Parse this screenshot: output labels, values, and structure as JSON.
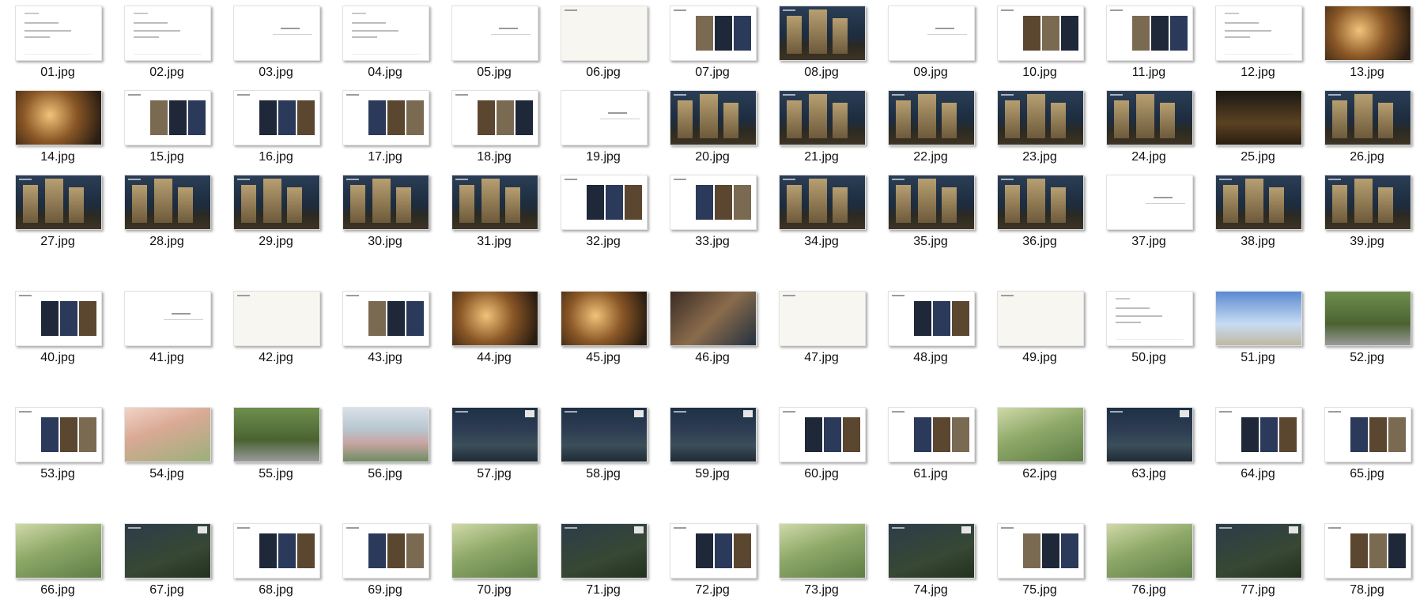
{
  "files": [
    {
      "name": "01.jpg",
      "style": "doc"
    },
    {
      "name": "02.jpg",
      "style": "doc"
    },
    {
      "name": "03.jpg",
      "style": "blank"
    },
    {
      "name": "04.jpg",
      "style": "doc"
    },
    {
      "name": "05.jpg",
      "style": "blank"
    },
    {
      "name": "06.jpg",
      "style": "plan"
    },
    {
      "name": "07.jpg",
      "style": "photos"
    },
    {
      "name": "08.jpg",
      "style": "night"
    },
    {
      "name": "09.jpg",
      "style": "blank"
    },
    {
      "name": "10.jpg",
      "style": "photos"
    },
    {
      "name": "11.jpg",
      "style": "photos"
    },
    {
      "name": "12.jpg",
      "style": "doc"
    },
    {
      "name": "13.jpg",
      "style": "warm"
    },
    {
      "name": "14.jpg",
      "style": "warm"
    },
    {
      "name": "15.jpg",
      "style": "photos"
    },
    {
      "name": "16.jpg",
      "style": "photos"
    },
    {
      "name": "17.jpg",
      "style": "photos"
    },
    {
      "name": "18.jpg",
      "style": "photos"
    },
    {
      "name": "19.jpg",
      "style": "blank"
    },
    {
      "name": "20.jpg",
      "style": "night"
    },
    {
      "name": "21.jpg",
      "style": "night"
    },
    {
      "name": "22.jpg",
      "style": "night"
    },
    {
      "name": "23.jpg",
      "style": "night"
    },
    {
      "name": "24.jpg",
      "style": "night"
    },
    {
      "name": "25.jpg",
      "style": "dark"
    },
    {
      "name": "26.jpg",
      "style": "night"
    },
    {
      "name": "27.jpg",
      "style": "night"
    },
    {
      "name": "28.jpg",
      "style": "night"
    },
    {
      "name": "29.jpg",
      "style": "night"
    },
    {
      "name": "30.jpg",
      "style": "night"
    },
    {
      "name": "31.jpg",
      "style": "night"
    },
    {
      "name": "32.jpg",
      "style": "photos"
    },
    {
      "name": "33.jpg",
      "style": "photos"
    },
    {
      "name": "34.jpg",
      "style": "night"
    },
    {
      "name": "35.jpg",
      "style": "night"
    },
    {
      "name": "36.jpg",
      "style": "night"
    },
    {
      "name": "37.jpg",
      "style": "blank"
    },
    {
      "name": "38.jpg",
      "style": "night"
    },
    {
      "name": "39.jpg",
      "style": "night"
    },
    {
      "name": "40.jpg",
      "style": "photos"
    },
    {
      "name": "41.jpg",
      "style": "blank"
    },
    {
      "name": "42.jpg",
      "style": "plan"
    },
    {
      "name": "43.jpg",
      "style": "photos"
    },
    {
      "name": "44.jpg",
      "style": "warm"
    },
    {
      "name": "45.jpg",
      "style": "warm"
    },
    {
      "name": "46.jpg",
      "style": "photo"
    },
    {
      "name": "47.jpg",
      "style": "plan"
    },
    {
      "name": "48.jpg",
      "style": "photos"
    },
    {
      "name": "49.jpg",
      "style": "plan"
    },
    {
      "name": "50.jpg",
      "style": "doc"
    },
    {
      "name": "51.jpg",
      "style": "sky"
    },
    {
      "name": "52.jpg",
      "style": "park"
    },
    {
      "name": "53.jpg",
      "style": "photos"
    },
    {
      "name": "54.jpg",
      "style": "pink"
    },
    {
      "name": "55.jpg",
      "style": "park"
    },
    {
      "name": "56.jpg",
      "style": "aerial"
    },
    {
      "name": "57.jpg",
      "style": "aernight"
    },
    {
      "name": "58.jpg",
      "style": "aernight"
    },
    {
      "name": "59.jpg",
      "style": "aernight"
    },
    {
      "name": "60.jpg",
      "style": "photos"
    },
    {
      "name": "61.jpg",
      "style": "photos"
    },
    {
      "name": "62.jpg",
      "style": "green"
    },
    {
      "name": "63.jpg",
      "style": "aernight"
    },
    {
      "name": "64.jpg",
      "style": "photos"
    },
    {
      "name": "65.jpg",
      "style": "photos"
    },
    {
      "name": "66.jpg",
      "style": "green"
    },
    {
      "name": "67.jpg",
      "style": "gnight"
    },
    {
      "name": "68.jpg",
      "style": "photos"
    },
    {
      "name": "69.jpg",
      "style": "photos"
    },
    {
      "name": "70.jpg",
      "style": "green"
    },
    {
      "name": "71.jpg",
      "style": "gnight"
    },
    {
      "name": "72.jpg",
      "style": "photos"
    },
    {
      "name": "73.jpg",
      "style": "green"
    },
    {
      "name": "74.jpg",
      "style": "gnight"
    },
    {
      "name": "75.jpg",
      "style": "photos"
    },
    {
      "name": "76.jpg",
      "style": "green"
    },
    {
      "name": "77.jpg",
      "style": "gnight"
    },
    {
      "name": "78.jpg",
      "style": "photos"
    }
  ]
}
